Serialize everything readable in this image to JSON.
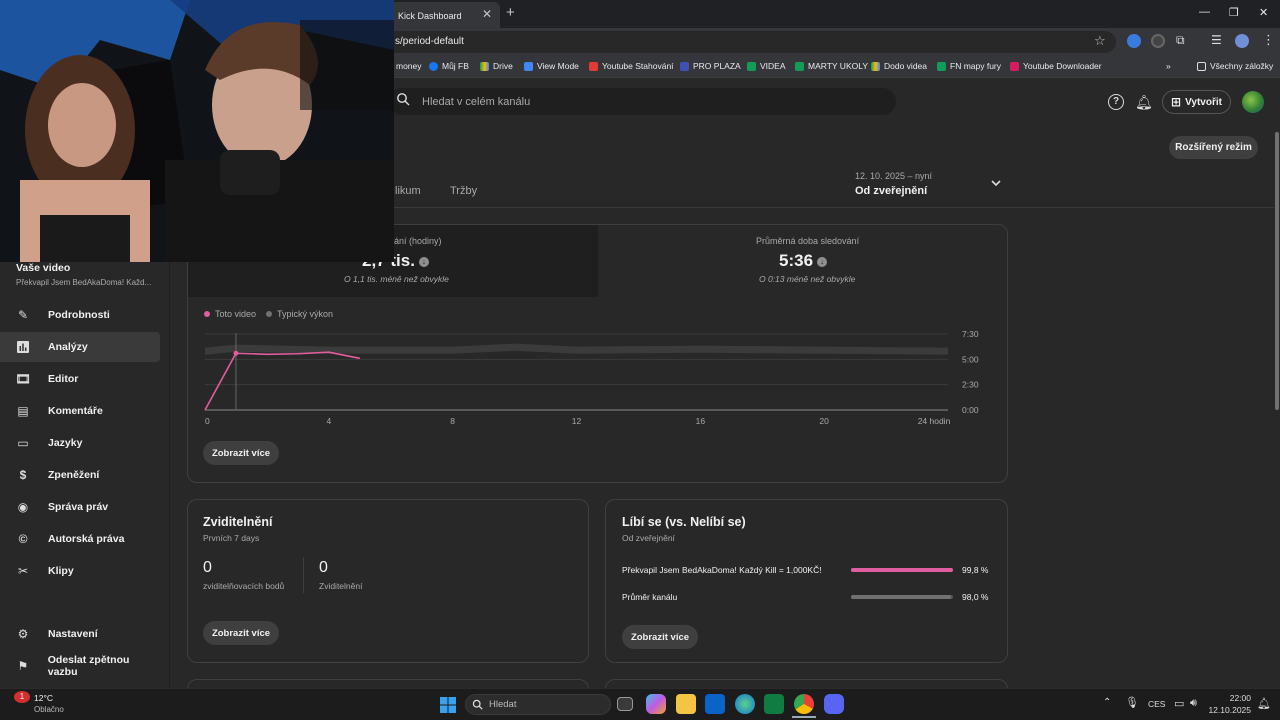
{
  "browser": {
    "active_tab_title": "Kick Dashboard",
    "address_url": "s/period-default",
    "bookmarks": [
      "money",
      "Můj FB",
      "Drive",
      "View Mode",
      "Youtube Stahování",
      "PRO PLAZA",
      "VIDEA",
      "MARTY UKOLY",
      "Dodo videa",
      "FN mapy fury",
      "Youtube Downloader"
    ],
    "bookmarks_more": "»",
    "all_bookmarks": "Všechny záložky"
  },
  "header": {
    "search_placeholder": "Hledat v celém kanálu",
    "create_label": "Vytvořit"
  },
  "toolbar": {
    "advanced_mode": "Rozšířený režim"
  },
  "tabs": [
    "likum",
    "Tržby"
  ],
  "date_range": {
    "range": "12. 10. 2025 – nyní",
    "label": "Od zveřejnění"
  },
  "sidebar": {
    "video_title": "Vaše video",
    "video_subtitle": "Překvapil Jsem BedAkaDoma! Každ...",
    "items": [
      {
        "label": "Podrobnosti",
        "icon": "pencil-icon"
      },
      {
        "label": "Analýzy",
        "icon": "analytics-icon"
      },
      {
        "label": "Editor",
        "icon": "editor-icon"
      },
      {
        "label": "Komentáře",
        "icon": "comments-icon"
      },
      {
        "label": "Jazyky",
        "icon": "languages-icon"
      },
      {
        "label": "Zpeněžení",
        "icon": "dollar-icon"
      },
      {
        "label": "Správa práv",
        "icon": "rights-icon"
      },
      {
        "label": "Autorská práva",
        "icon": "copyright-icon"
      },
      {
        "label": "Klipy",
        "icon": "scissors-icon"
      }
    ],
    "settings": "Nastavení",
    "feedback": "Odeslat zpětnou vazbu"
  },
  "metrics": {
    "left": {
      "label": "ání (hodiny)",
      "value": "2,7 tis.",
      "sub": "O 1,1 tis. méně než obvykle"
    },
    "right": {
      "label": "Průměrná doba sledování",
      "value": "5:36",
      "sub": "O 0:13 méně než obvykle"
    }
  },
  "legend": {
    "this_video": "Toto video",
    "typical": "Typický výkon",
    "this_color": "#e05da0",
    "typical_color": "#717171"
  },
  "chart_data": {
    "type": "line",
    "title": "",
    "xlabel": "",
    "ylabel": "",
    "x_ticks": [
      "0",
      "4",
      "8",
      "12",
      "16",
      "20",
      "24 hodin"
    ],
    "y_ticks": [
      "0:00",
      "2:30",
      "5:00",
      "7:30"
    ],
    "xlim": [
      0,
      24
    ],
    "ylim": [
      0,
      7.5
    ],
    "series": [
      {
        "name": "Toto video",
        "x": [
          0,
          1,
          2,
          3,
          4,
          5
        ],
        "y": [
          0,
          5.6,
          5.5,
          5.55,
          5.7,
          5.1
        ]
      },
      {
        "name": "Typický výkon",
        "x": [
          0,
          1,
          4,
          8,
          10,
          12,
          16,
          20,
          24
        ],
        "y": [
          5.8,
          6.1,
          5.9,
          5.9,
          6.2,
          5.9,
          6.0,
          5.9,
          5.8
        ]
      }
    ]
  },
  "main_more_button": "Zobrazit více",
  "visibility": {
    "title": "Zviditelnění",
    "subtitle": "Prvních 7 days",
    "points_value": "0",
    "points_label": "zviditelňovacích bodů",
    "promotions_value": "0",
    "promotions_label": "Zviditelnění",
    "more_button": "Zobrazit více"
  },
  "likes": {
    "title": "Líbí se (vs. Nelíbí se)",
    "subtitle": "Od zveřejnění",
    "rows": [
      {
        "label": "Překvapil Jsem BedAkaDoma! Každý Kill = 1,000KČ!",
        "value": "99,8 %",
        "fraction": 0.998,
        "color": "#e05da0"
      },
      {
        "label": "Průměr kanálu",
        "value": "98,0 %",
        "fraction": 0.98,
        "color": "#717171"
      }
    ],
    "more_button": "Zobrazit více"
  },
  "taskbar": {
    "weather_temp": "12°C",
    "weather_desc": "Oblačno",
    "weather_badge": "1",
    "search_placeholder": "Hledat",
    "language": "CES",
    "time": "22:00",
    "date": "12.10.2025"
  }
}
